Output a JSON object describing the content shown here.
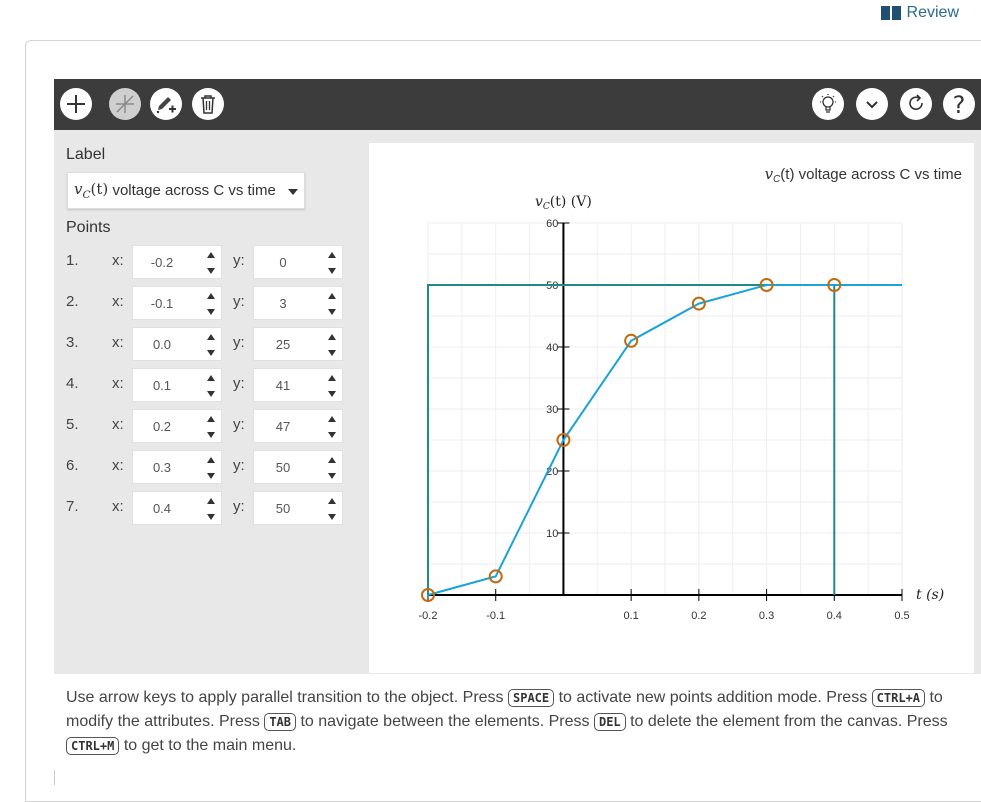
{
  "review": {
    "label": "Review"
  },
  "sidebar": {
    "label_title": "Label",
    "dropdown_var": "v",
    "dropdown_sub": "C",
    "dropdown_arg": "(t)",
    "dropdown_text": "voltage across C vs time",
    "points_title": "Points",
    "x_label": "x:",
    "y_label": "y:",
    "points": [
      {
        "index": "1.",
        "x": "-0.2",
        "y": "0"
      },
      {
        "index": "2.",
        "x": "-0.1",
        "y": "3"
      },
      {
        "index": "3.",
        "x": "0.0",
        "y": "25"
      },
      {
        "index": "4.",
        "x": "0.1",
        "y": "41"
      },
      {
        "index": "5.",
        "x": "0.2",
        "y": "47"
      },
      {
        "index": "6.",
        "x": "0.3",
        "y": "50"
      },
      {
        "index": "7.",
        "x": "0.4",
        "y": "50"
      }
    ]
  },
  "toolbar": {
    "left_icons": [
      "add-icon",
      "no-slope-icon",
      "edit-pen-add-icon",
      "trash-icon"
    ],
    "right_icons": [
      "lightbulb-icon",
      "chevron-down-icon",
      "redo-icon",
      "help-icon"
    ]
  },
  "chart_data": {
    "type": "line",
    "title_var": "v",
    "title_sub": "C",
    "title_text": "(t) voltage across C vs time",
    "ylabel": "(t) (V)",
    "xlabel": "t (s)",
    "xlim": [
      -0.2,
      0.5
    ],
    "ylim": [
      0,
      60
    ],
    "xticks": [
      "-0.2",
      "-0.1",
      "0.1",
      "0.2",
      "0.3",
      "0.4",
      "0.5"
    ],
    "yticks": [
      "10",
      "20",
      "30",
      "40",
      "50",
      "60"
    ],
    "series": [
      {
        "x": [
          -0.2,
          -0.1,
          0.0,
          0.1,
          0.2,
          0.3,
          0.4
        ],
        "y": [
          0,
          3,
          25,
          41,
          47,
          50,
          50
        ],
        "color": "#1aa3d6"
      }
    ],
    "extension": {
      "x_from": 0.4,
      "x_to": 0.5,
      "y": 50
    },
    "guide_box": {
      "x0": -0.2,
      "x1": 0.4,
      "y": 50,
      "color": "#1f8a8a"
    },
    "marker_color": "#c06b10",
    "grid": true
  },
  "help": {
    "t1": "Use arrow keys to apply parallel transition to the object. Press",
    "k1": "SPACE",
    "t2": "to activate new points addition mode. Press",
    "k2": "CTRL+A",
    "t3": "to modify the attributes. Press",
    "k3": "TAB",
    "t4": "to navigate between the elements. Press",
    "k4": "DEL",
    "t5": "to delete the element from the canvas. Press",
    "k5": "CTRL+M",
    "t6": "to get to the main menu."
  }
}
